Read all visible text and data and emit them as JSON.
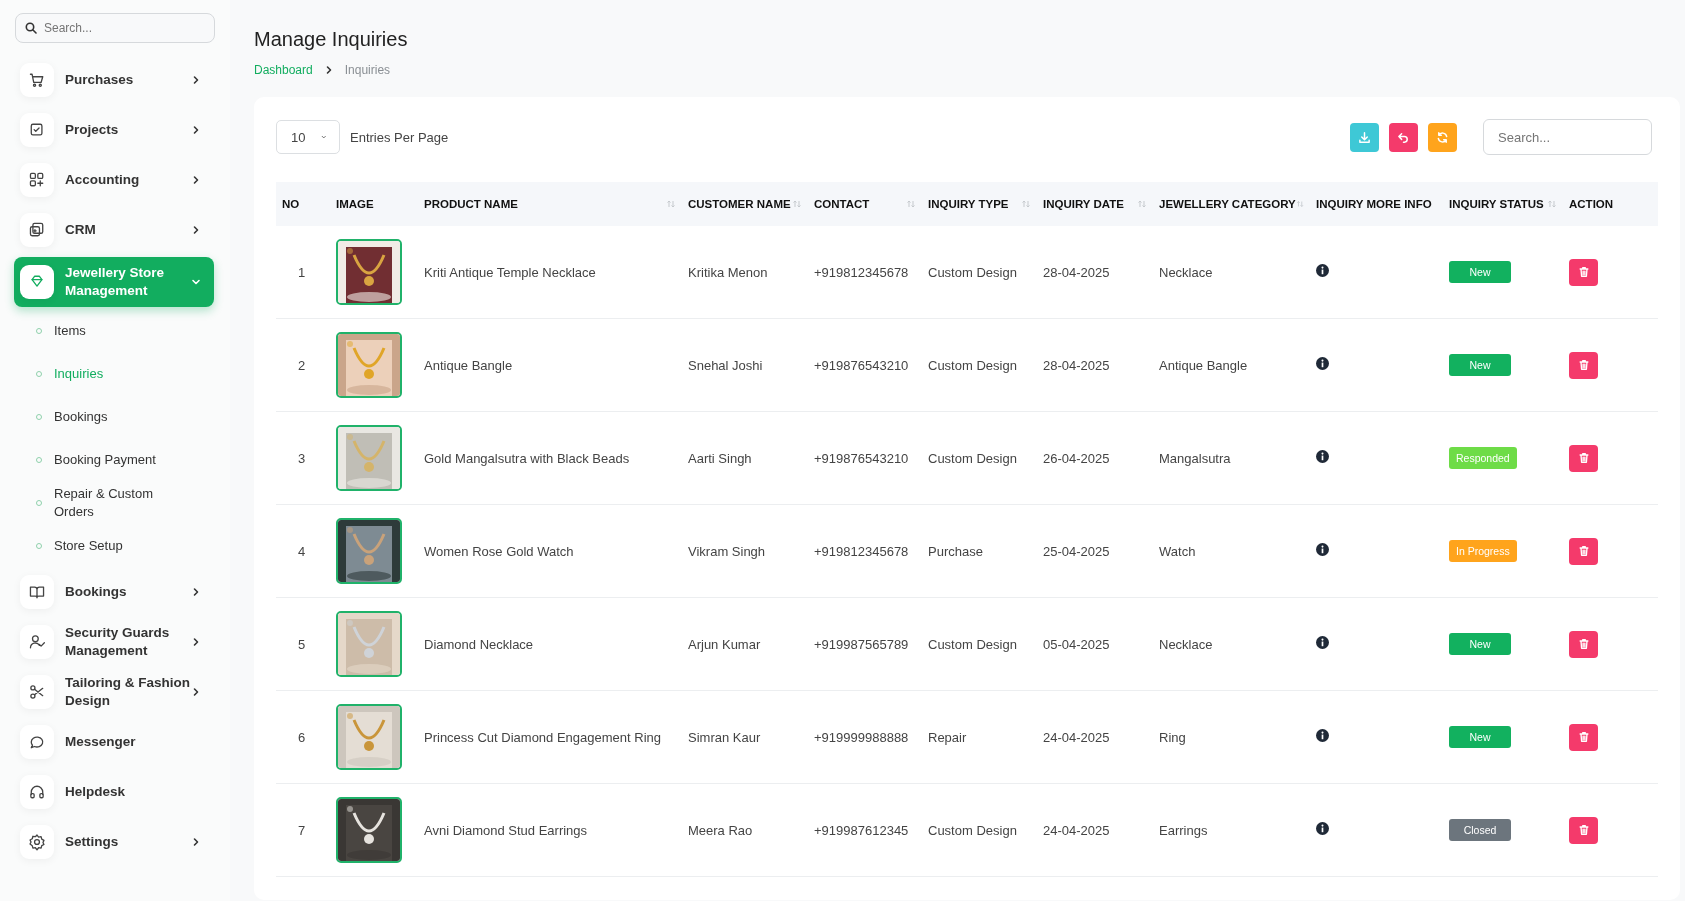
{
  "sidebar": {
    "search": {
      "placeholder": "Search..."
    },
    "items": [
      {
        "label": "Purchases",
        "kind": "group",
        "expandable": true,
        "expanded": false,
        "selected": false
      },
      {
        "label": "Projects",
        "kind": "group",
        "expandable": true,
        "expanded": false,
        "selected": false
      },
      {
        "label": "Accounting",
        "kind": "group",
        "expandable": true,
        "expanded": false,
        "selected": false
      },
      {
        "label": "CRM",
        "kind": "group",
        "expandable": true,
        "expanded": false,
        "selected": false
      },
      {
        "label": "Jewellery Store Management",
        "kind": "group",
        "expandable": true,
        "expanded": true,
        "selected": true,
        "children": [
          {
            "label": "Items",
            "selected": false
          },
          {
            "label": "Inquiries",
            "selected": true
          },
          {
            "label": "Bookings",
            "selected": false
          },
          {
            "label": "Booking Payment",
            "selected": false
          },
          {
            "label": "Repair & Custom Orders",
            "selected": false
          },
          {
            "label": "Store Setup",
            "selected": false
          }
        ]
      },
      {
        "label": "Bookings",
        "kind": "group",
        "expandable": true,
        "expanded": false,
        "selected": false
      },
      {
        "label": "Security Guards Management",
        "kind": "group",
        "expandable": true,
        "expanded": false,
        "selected": false
      },
      {
        "label": "Tailoring & Fashion Design",
        "kind": "group",
        "expandable": true,
        "expanded": false,
        "selected": false
      },
      {
        "label": "Messenger",
        "kind": "group",
        "expandable": false,
        "selected": false
      },
      {
        "label": "Helpdesk",
        "kind": "group",
        "expandable": false,
        "selected": false
      },
      {
        "label": "Settings",
        "kind": "group",
        "expandable": true,
        "expanded": false,
        "selected": false
      }
    ]
  },
  "page": {
    "title": "Manage Inquiries",
    "breadcrumb": [
      "Dashboard",
      "Inquiries"
    ]
  },
  "toolbar": {
    "entries": "10",
    "entries_label": "Entries Per Page",
    "search": {
      "placeholder": "Search..."
    }
  },
  "table": {
    "columns": [
      {
        "label": "NO",
        "sortable": false
      },
      {
        "label": "IMAGE",
        "sortable": false
      },
      {
        "label": "PRODUCT NAME",
        "sortable": true
      },
      {
        "label": "CUSTOMER NAME",
        "sortable": true
      },
      {
        "label": "CONTACT",
        "sortable": true
      },
      {
        "label": "INQUIRY TYPE",
        "sortable": true
      },
      {
        "label": "INQUIRY DATE",
        "sortable": true
      },
      {
        "label": "JEWELLERY CATEGORY",
        "sortable": true
      },
      {
        "label": "INQUIRY MORE INFO",
        "sortable": false
      },
      {
        "label": "INQUIRY STATUS",
        "sortable": true
      },
      {
        "label": "ACTION",
        "sortable": false
      }
    ],
    "rows": [
      {
        "no": "1",
        "product": "Kriti Antique Temple Necklace",
        "customer": "Kritika Menon",
        "contact": "+919812345678",
        "type": "Custom Design",
        "date": "28-04-2025",
        "category": "Necklace",
        "status": {
          "label": "New",
          "color": "#12b15f"
        }
      },
      {
        "no": "2",
        "product": "Antique Bangle",
        "customer": "Snehal Joshi",
        "contact": "+919876543210",
        "type": "Custom Design",
        "date": "28-04-2025",
        "category": "Antique Bangle",
        "status": {
          "label": "New",
          "color": "#12b15f"
        }
      },
      {
        "no": "3",
        "product": "Gold Mangalsutra with Black Beads",
        "customer": "Aarti Singh",
        "contact": "+919876543210",
        "type": "Custom Design",
        "date": "26-04-2025",
        "category": "Mangalsutra",
        "status": {
          "label": "Responded",
          "color": "#6edc47"
        }
      },
      {
        "no": "4",
        "product": "Women Rose Gold Watch",
        "customer": "Vikram Singh",
        "contact": "+919812345678",
        "type": "Purchase",
        "date": "25-04-2025",
        "category": "Watch",
        "status": {
          "label": "In Progress",
          "color": "#ffa41c"
        }
      },
      {
        "no": "5",
        "product": "Diamond Necklace",
        "customer": "Arjun Kumar",
        "contact": "+919987565789",
        "type": "Custom Design",
        "date": "05-04-2025",
        "category": "Necklace",
        "status": {
          "label": "New",
          "color": "#12b15f"
        }
      },
      {
        "no": "6",
        "product": "Princess Cut Diamond Engagement Ring",
        "customer": "Simran Kaur",
        "contact": "+919999988888",
        "type": "Repair",
        "date": "24-04-2025",
        "category": "Ring",
        "status": {
          "label": "New",
          "color": "#12b15f"
        }
      },
      {
        "no": "7",
        "product": "Avni Diamond Stud Earrings",
        "customer": "Meera Rao",
        "contact": "+919987612345",
        "type": "Custom Design",
        "date": "24-04-2025",
        "category": "Earrings",
        "status": {
          "label": "Closed",
          "color": "#6c757d"
        }
      }
    ]
  }
}
